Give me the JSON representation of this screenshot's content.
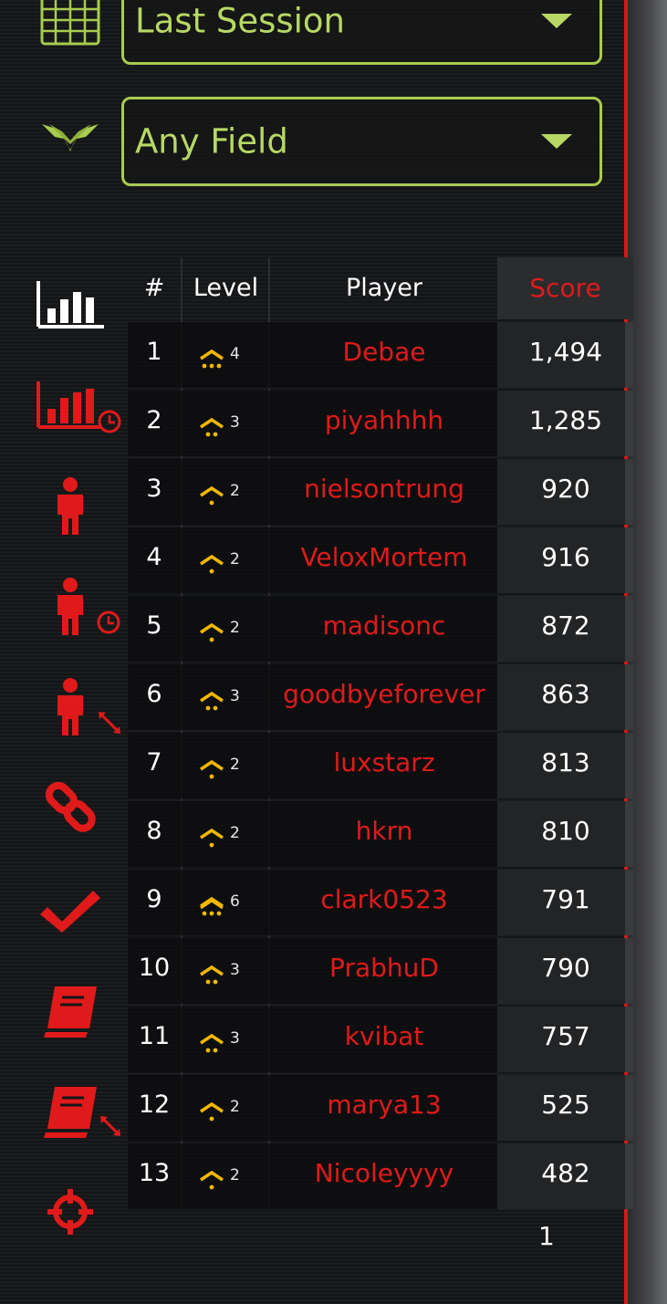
{
  "filters": {
    "session": {
      "value": "Last Session",
      "icon": "calendar-icon"
    },
    "field": {
      "value": "Any Field",
      "icon": "wings-icon"
    }
  },
  "categories": [
    {
      "icon": "bar-chart-icon",
      "active": true
    },
    {
      "icon": "bar-chart-clock-icon",
      "active": false
    },
    {
      "icon": "person-icon",
      "active": false
    },
    {
      "icon": "person-clock-icon",
      "active": false
    },
    {
      "icon": "person-resize-icon",
      "active": false
    },
    {
      "icon": "link-icon",
      "active": false
    },
    {
      "icon": "check-icon",
      "active": false
    },
    {
      "icon": "book-icon",
      "active": false
    },
    {
      "icon": "book-resize-icon",
      "active": false
    },
    {
      "icon": "crosshair-icon",
      "active": false
    }
  ],
  "table": {
    "headers": {
      "rank": "#",
      "level": "Level",
      "player": "Player",
      "score": "Score"
    },
    "rows": [
      {
        "rank": "1",
        "level": "4",
        "player": "Debae",
        "score": "1,494"
      },
      {
        "rank": "2",
        "level": "3",
        "player": "piyahhhh",
        "score": "1,285"
      },
      {
        "rank": "3",
        "level": "2",
        "player": "nielsontrung",
        "score": "920"
      },
      {
        "rank": "4",
        "level": "2",
        "player": "VeloxMortem",
        "score": "916"
      },
      {
        "rank": "5",
        "level": "2",
        "player": "madisonc",
        "score": "872"
      },
      {
        "rank": "6",
        "level": "3",
        "player": "goodbyeforever",
        "score": "863"
      },
      {
        "rank": "7",
        "level": "2",
        "player": "luxstarz",
        "score": "813"
      },
      {
        "rank": "8",
        "level": "2",
        "player": "hkrn",
        "score": "810"
      },
      {
        "rank": "9",
        "level": "6",
        "player": "clark0523",
        "score": "791"
      },
      {
        "rank": "10",
        "level": "3",
        "player": "PrabhuD",
        "score": "790"
      },
      {
        "rank": "11",
        "level": "3",
        "player": "kvibat",
        "score": "757"
      },
      {
        "rank": "12",
        "level": "2",
        "player": "marya13",
        "score": "525"
      },
      {
        "rank": "13",
        "level": "2",
        "player": "Nicoleyyyy",
        "score": "482"
      }
    ]
  },
  "pager": {
    "page": "1"
  },
  "colors": {
    "accent_green": "#b7d865",
    "accent_red": "#e01a1a",
    "level_gold": "#f0b800"
  }
}
